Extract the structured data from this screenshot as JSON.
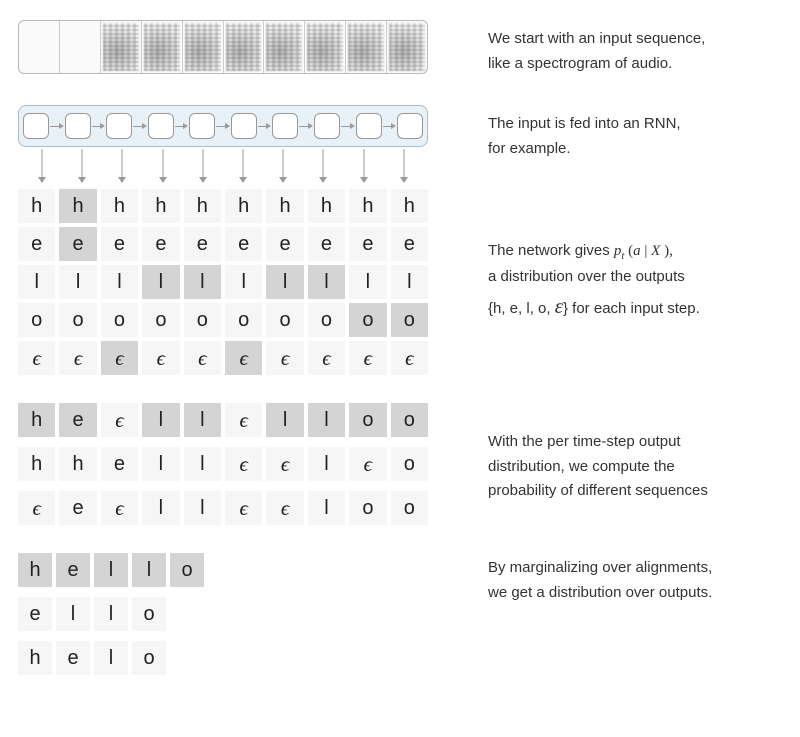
{
  "captions": {
    "spectro": [
      "We start with an input sequence,",
      "like a spectrogram of audio."
    ],
    "rnn": [
      "The input is fed into an RNN,",
      "for example."
    ],
    "dist_pre": "The network gives ",
    "dist_math": {
      "p": "p",
      "t": "t",
      "open": " (",
      "a": "a",
      "bar": " | ",
      "X": "X",
      "close": " ),"
    },
    "dist_post1": "a distribution over the outputs",
    "dist_post2_pre": "{h, e, l, o, ",
    "dist_post2_eps": "ε",
    "dist_post2_post": "} for each input step.",
    "seq": [
      "With the per time-step output",
      "distribution, we compute the",
      "probability of different sequences"
    ],
    "marg": [
      "By marginalizing over alignments,",
      "we get a distribution over outputs."
    ]
  },
  "num_steps": 10,
  "spectro_intensity": [
    0,
    0,
    1,
    1,
    1,
    1,
    1,
    1,
    1,
    1
  ],
  "alphabet": [
    "h",
    "e",
    "l",
    "o",
    "ε"
  ],
  "dist_grid": {
    "rows": [
      {
        "char": "h",
        "dark": [
          0,
          1,
          0,
          0,
          0,
          0,
          0,
          0,
          0,
          0
        ]
      },
      {
        "char": "e",
        "dark": [
          0,
          1,
          0,
          0,
          0,
          0,
          0,
          0,
          0,
          0
        ]
      },
      {
        "char": "l",
        "dark": [
          0,
          0,
          0,
          1,
          1,
          0,
          1,
          1,
          0,
          0
        ]
      },
      {
        "char": "o",
        "dark": [
          0,
          0,
          0,
          0,
          0,
          0,
          0,
          0,
          1,
          1
        ]
      },
      {
        "char": "ε",
        "dark": [
          0,
          0,
          1,
          0,
          0,
          1,
          0,
          0,
          0,
          0
        ]
      }
    ]
  },
  "sequences": [
    {
      "chars": [
        "h",
        "e",
        "ε",
        "l",
        "l",
        "ε",
        "l",
        "l",
        "o",
        "o"
      ],
      "dark": [
        1,
        1,
        0,
        1,
        1,
        0,
        1,
        1,
        1,
        1
      ]
    },
    {
      "chars": [
        "h",
        "h",
        "e",
        "l",
        "l",
        "ε",
        "ε",
        "l",
        "ε",
        "o"
      ],
      "dark": [
        0,
        0,
        0,
        0,
        0,
        0,
        0,
        0,
        0,
        0
      ]
    },
    {
      "chars": [
        "ε",
        "e",
        "ε",
        "l",
        "l",
        "ε",
        "ε",
        "l",
        "o",
        "o"
      ],
      "dark": [
        0,
        0,
        0,
        0,
        0,
        0,
        0,
        0,
        0,
        0
      ]
    }
  ],
  "outputs": [
    {
      "chars": [
        "h",
        "e",
        "l",
        "l",
        "o"
      ],
      "dark": [
        1,
        1,
        1,
        1,
        1
      ]
    },
    {
      "chars": [
        "e",
        "l",
        "l",
        "o"
      ],
      "dark": [
        0,
        0,
        0,
        0
      ]
    },
    {
      "chars": [
        "h",
        "e",
        "l",
        "o"
      ],
      "dark": [
        0,
        0,
        0,
        0
      ]
    }
  ]
}
